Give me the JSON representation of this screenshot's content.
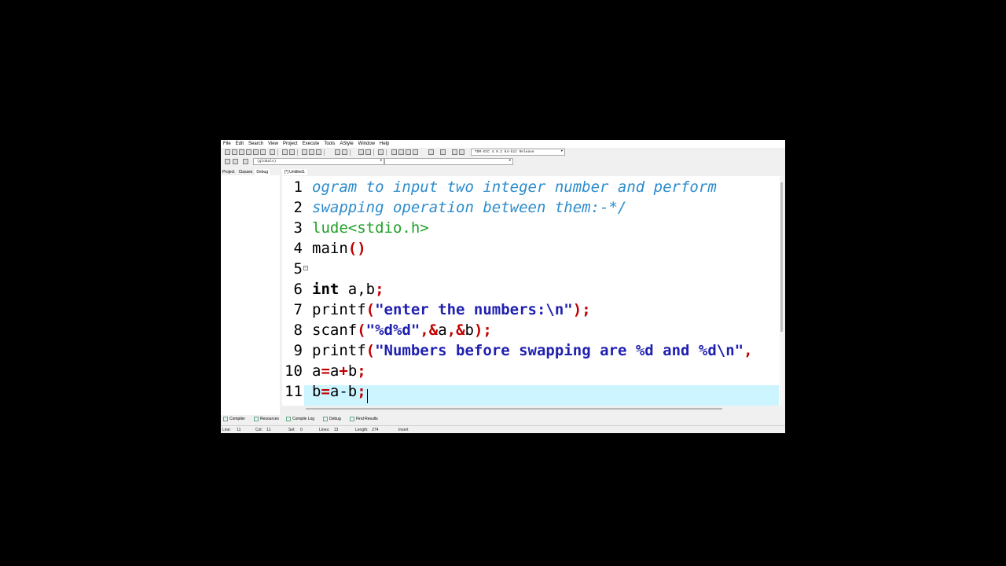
{
  "menu": [
    "File",
    "Edit",
    "Search",
    "View",
    "Project",
    "Execute",
    "Tools",
    "AStyle",
    "Window",
    "Help"
  ],
  "toolbar": {
    "compiler_select": "TDM-GCC 4.9.2 64-bit Release",
    "scope_select": "(globals)",
    "function_select": ""
  },
  "left_panel": {
    "tabs": [
      "Project",
      "Classes",
      "Debug"
    ],
    "active_tab": "Debug"
  },
  "editor": {
    "file_tab": "[*] Untitled1",
    "line_numbers": [
      "1",
      "2",
      "3",
      "4",
      "5",
      "6",
      "7",
      "8",
      "9",
      "10",
      "11"
    ],
    "lines": [
      [
        {
          "t": "ogram to input two integer number and perform",
          "c": "cm"
        }
      ],
      [
        {
          "t": "swapping operation between them:-*/",
          "c": "cm"
        }
      ],
      [
        {
          "t": "lude<stdio.h>",
          "c": "pp"
        }
      ],
      [
        {
          "t": "main",
          "c": ""
        },
        {
          "t": "()",
          "c": "sy"
        }
      ],
      [
        {
          "t": "",
          "c": ""
        }
      ],
      [
        {
          "t": "int",
          "c": "kw"
        },
        {
          "t": " a,b",
          "c": ""
        },
        {
          "t": ";",
          "c": "sy"
        }
      ],
      [
        {
          "t": "printf",
          "c": ""
        },
        {
          "t": "(",
          "c": "sy"
        },
        {
          "t": "\"enter the numbers:\\n\"",
          "c": "st"
        },
        {
          "t": ");",
          "c": "sy"
        }
      ],
      [
        {
          "t": "scanf",
          "c": ""
        },
        {
          "t": "(",
          "c": "sy"
        },
        {
          "t": "\"%d%d\"",
          "c": "st"
        },
        {
          "t": ",&",
          "c": "sy"
        },
        {
          "t": "a",
          "c": ""
        },
        {
          "t": ",&",
          "c": "sy"
        },
        {
          "t": "b",
          "c": ""
        },
        {
          "t": ");",
          "c": "sy"
        }
      ],
      [
        {
          "t": "printf",
          "c": ""
        },
        {
          "t": "(",
          "c": "sy"
        },
        {
          "t": "\"Numbers before swapping are %d and %d\\n\"",
          "c": "st"
        },
        {
          "t": ",",
          "c": "sy"
        }
      ],
      [
        {
          "t": "a",
          "c": ""
        },
        {
          "t": "=",
          "c": "sy"
        },
        {
          "t": "a",
          "c": ""
        },
        {
          "t": "+",
          "c": "sy"
        },
        {
          "t": "b",
          "c": ""
        },
        {
          "t": ";",
          "c": "sy"
        }
      ],
      [
        {
          "t": "b",
          "c": ""
        },
        {
          "t": "=",
          "c": "sy"
        },
        {
          "t": "a-b",
          "c": ""
        },
        {
          "t": ";",
          "c": "sy"
        }
      ]
    ],
    "current_line_color": "#ccf5ff"
  },
  "bottom_tabs": [
    "Compiler",
    "Resources",
    "Compile Log",
    "Debug",
    "Find Results"
  ],
  "status": {
    "line_label": "Line:",
    "line": "11",
    "col_label": "Col:",
    "col": "11",
    "sel_label": "Sel:",
    "sel": "0",
    "lines_label": "Lines:",
    "lines": "13",
    "length_label": "Length:",
    "length": "274",
    "mode": "Insert"
  }
}
